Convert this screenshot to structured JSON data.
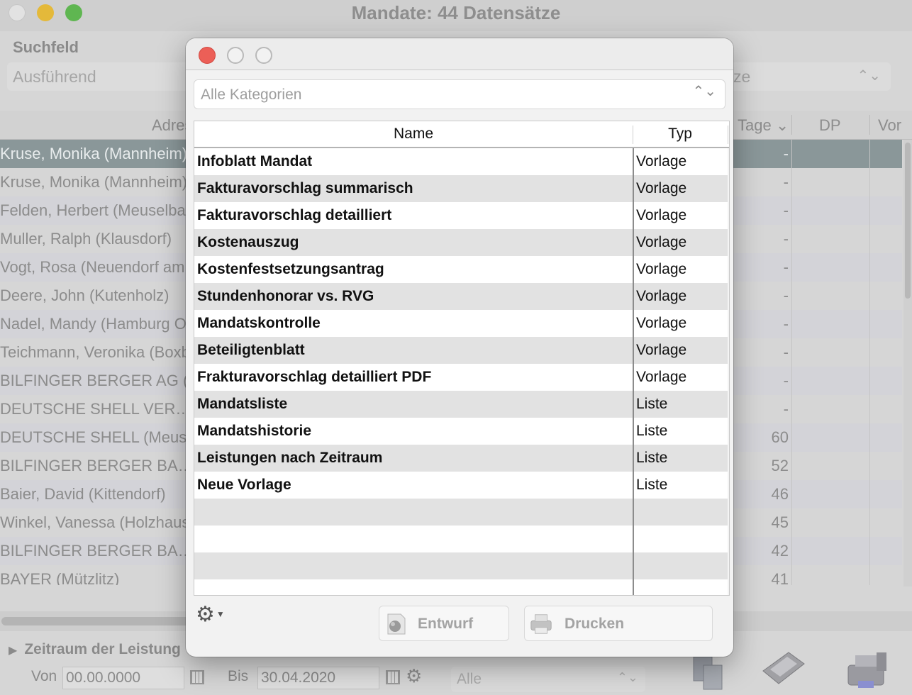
{
  "background_window": {
    "title": "Mandate: 44 Datensätze",
    "search_label": "Suchfeld",
    "search_select_value": "Ausführend",
    "right_select_value": "ze",
    "right_select_chevron": "⌃⌄",
    "columns": {
      "address": "Adres",
      "tage": "Tage ⌄",
      "dp": "DP",
      "vor": "Vor"
    },
    "rows": [
      {
        "name": "Kruse, Monika (Mannheim)",
        "tage": "-",
        "selected": true
      },
      {
        "name": "Kruse, Monika (Mannheim)",
        "tage": "-"
      },
      {
        "name": "Felden, Herbert (Meuselba",
        "tage": "-"
      },
      {
        "name": "Muller, Ralph (Klausdorf)",
        "tage": "-"
      },
      {
        "name": "Vogt, Rosa (Neuendorf am",
        "tage": "-"
      },
      {
        "name": "Deere, John (Kutenholz)",
        "tage": "-"
      },
      {
        "name": "Nadel, Mandy (Hamburg O",
        "tage": "-"
      },
      {
        "name": "Teichmann, Veronika (Boxb",
        "tage": "-"
      },
      {
        "name": "BILFINGER BERGER AG (H",
        "tage": "-"
      },
      {
        "name": "DEUTSCHE SHELL VER…",
        "tage": "-"
      },
      {
        "name": "DEUTSCHE SHELL (Meuse",
        "tage": "60"
      },
      {
        "name": "BILFINGER BERGER BA…",
        "tage": "52"
      },
      {
        "name": "Baier, David (Kittendorf)",
        "tage": "46"
      },
      {
        "name": "Winkel, Vanessa (Holzhaus",
        "tage": "45"
      },
      {
        "name": "BILFINGER BERGER BA…",
        "tage": "42"
      },
      {
        "name": "BAYER (Mützlitz)",
        "tage": "41"
      }
    ],
    "section_title": "Zeitraum der Leistung",
    "von_label": "Von",
    "von_value": "00.00.0000",
    "bis_label": "Bis",
    "bis_value": "30.04.2020",
    "filter_select_value": "Alle",
    "filter_select_chevron": "⌃⌄"
  },
  "dialog": {
    "category_select": {
      "value": "Alle Kategorien",
      "chevron": "⌃⌄"
    },
    "table": {
      "headers": {
        "name": "Name",
        "typ": "Typ"
      },
      "rows": [
        {
          "name": "Infoblatt Mandat",
          "typ": "Vorlage"
        },
        {
          "name": "Fakturavorschlag summarisch",
          "typ": "Vorlage"
        },
        {
          "name": "Fakturavorschlag detailliert",
          "typ": "Vorlage"
        },
        {
          "name": "Kostenauszug",
          "typ": "Vorlage"
        },
        {
          "name": "Kostenfestsetzungsantrag",
          "typ": "Vorlage"
        },
        {
          "name": "Stundenhonorar vs. RVG",
          "typ": "Vorlage"
        },
        {
          "name": "Mandatskontrolle",
          "typ": "Vorlage"
        },
        {
          "name": "Beteiligtenblatt",
          "typ": "Vorlage"
        },
        {
          "name": "Frakturavorschlag detailliert PDF",
          "typ": "Vorlage"
        },
        {
          "name": "Mandatsliste",
          "typ": "Liste"
        },
        {
          "name": "Mandatshistorie",
          "typ": "Liste"
        },
        {
          "name": "Leistungen nach Zeitraum",
          "typ": "Liste"
        },
        {
          "name": "Neue Vorlage",
          "typ": "Liste"
        }
      ],
      "empty_rows": 4
    },
    "buttons": {
      "entwurf": "Entwurf",
      "drucken": "Drucken"
    },
    "icons": {
      "gear": "gear-icon",
      "close": "close-icon",
      "minimize": "minimize-icon",
      "zoom": "zoom-icon"
    }
  }
}
